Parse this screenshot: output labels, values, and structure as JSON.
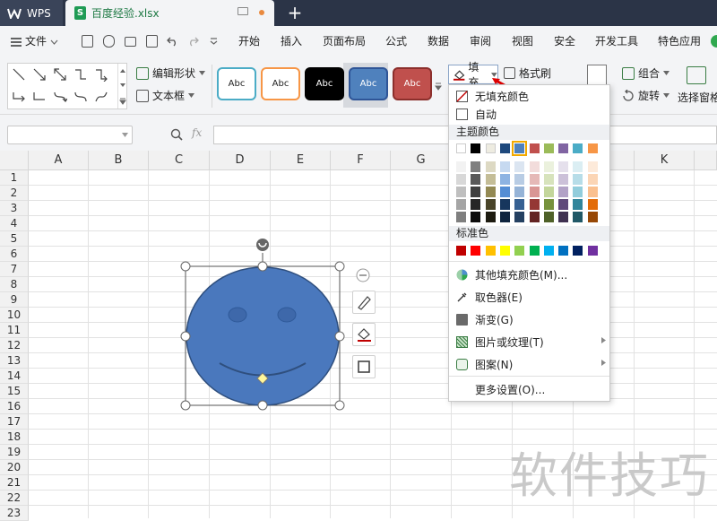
{
  "titlebar": {
    "app_name": "WPS",
    "file_name": "百度经验.xlsx",
    "file_icon_letter": "S",
    "new_tab": "+"
  },
  "menubar": {
    "file_menu": "文件",
    "tabs": [
      "开始",
      "插入",
      "页面布局",
      "公式",
      "数据",
      "审阅",
      "视图",
      "安全",
      "开发工具",
      "特色应用"
    ]
  },
  "ribbon": {
    "edit_shape": "编辑形状",
    "text_box": "文本框",
    "styles": [
      {
        "label": "Abc",
        "border": "#4bacc6",
        "bg": "#ffffff",
        "fg": "#222222"
      },
      {
        "label": "Abc",
        "border": "#f79646",
        "bg": "#ffffff",
        "fg": "#222222"
      },
      {
        "label": "Abc",
        "border": "#000000",
        "bg": "#000000",
        "fg": "#ffffff"
      },
      {
        "label": "Abc",
        "border": "#2f5597",
        "bg": "#4f81bd",
        "fg": "#ffffff"
      },
      {
        "label": "Abc",
        "border": "#8c2f2c",
        "bg": "#c0504d",
        "fg": "#ffffff"
      }
    ],
    "fill": "填充",
    "format_painter": "格式刷",
    "group": "组合",
    "rotate": "旋转",
    "selection_pane": "选择窗格"
  },
  "formula_bar": {
    "fx": "fx",
    "name_box_value": "",
    "formula_value": ""
  },
  "grid": {
    "columns": [
      "A",
      "B",
      "C",
      "D",
      "E",
      "F",
      "G",
      "K"
    ],
    "rows": [
      "1",
      "2",
      "3",
      "4",
      "5",
      "6",
      "7",
      "8",
      "9",
      "10",
      "11",
      "12",
      "13",
      "14",
      "15",
      "16",
      "17",
      "18",
      "19",
      "20",
      "21",
      "22",
      "23"
    ]
  },
  "shape": {
    "fill_color": "#4a78bd",
    "outline_color": "#2f4f7e"
  },
  "fill_menu": {
    "no_fill": "无填充颜色",
    "auto": "自动",
    "theme_colors_title": "主题颜色",
    "theme_top": [
      "#ffffff",
      "#000000",
      "#eeece1",
      "#1f497d",
      "#4f81bd",
      "#c0504d",
      "#9bbb59",
      "#8064a2",
      "#4bacc6",
      "#f79646"
    ],
    "theme_shades": [
      [
        "#f2f2f2",
        "#7f7f7f",
        "#ddd9c3",
        "#c6d9f0",
        "#dbe5f1",
        "#f2dcdb",
        "#ebf1dd",
        "#e5e0ec",
        "#dbeef3",
        "#fdeada"
      ],
      [
        "#d8d8d8",
        "#595959",
        "#c4bd97",
        "#8db3e2",
        "#b8cce4",
        "#e5b9b7",
        "#d7e3bc",
        "#ccc1d9",
        "#b7dde8",
        "#fbd5b5"
      ],
      [
        "#bfbfbf",
        "#3f3f3f",
        "#938953",
        "#548dd4",
        "#95b3d7",
        "#d99694",
        "#c3d69b",
        "#b2a2c7",
        "#92cddc",
        "#fac08f"
      ],
      [
        "#a5a5a5",
        "#262626",
        "#494429",
        "#17365d",
        "#366092",
        "#953734",
        "#76923c",
        "#5f497a",
        "#31859b",
        "#e36c09"
      ],
      [
        "#7f7f7f",
        "#0c0c0c",
        "#1d1b10",
        "#0f243e",
        "#244061",
        "#632423",
        "#4f6128",
        "#3f3151",
        "#205867",
        "#974806"
      ]
    ],
    "standard_colors_title": "标准色",
    "standard": [
      "#c00000",
      "#ff0000",
      "#ffc000",
      "#ffff00",
      "#92d050",
      "#00b050",
      "#00b0f0",
      "#0070c0",
      "#002060",
      "#7030a0"
    ],
    "more_colors": "其他填充颜色(M)...",
    "eyedropper": "取色器(E)",
    "gradient": "渐变(G)",
    "picture_texture": "图片或纹理(T)",
    "pattern": "图案(N)",
    "more_settings": "更多设置(O)..."
  },
  "watermark": "软件技巧"
}
